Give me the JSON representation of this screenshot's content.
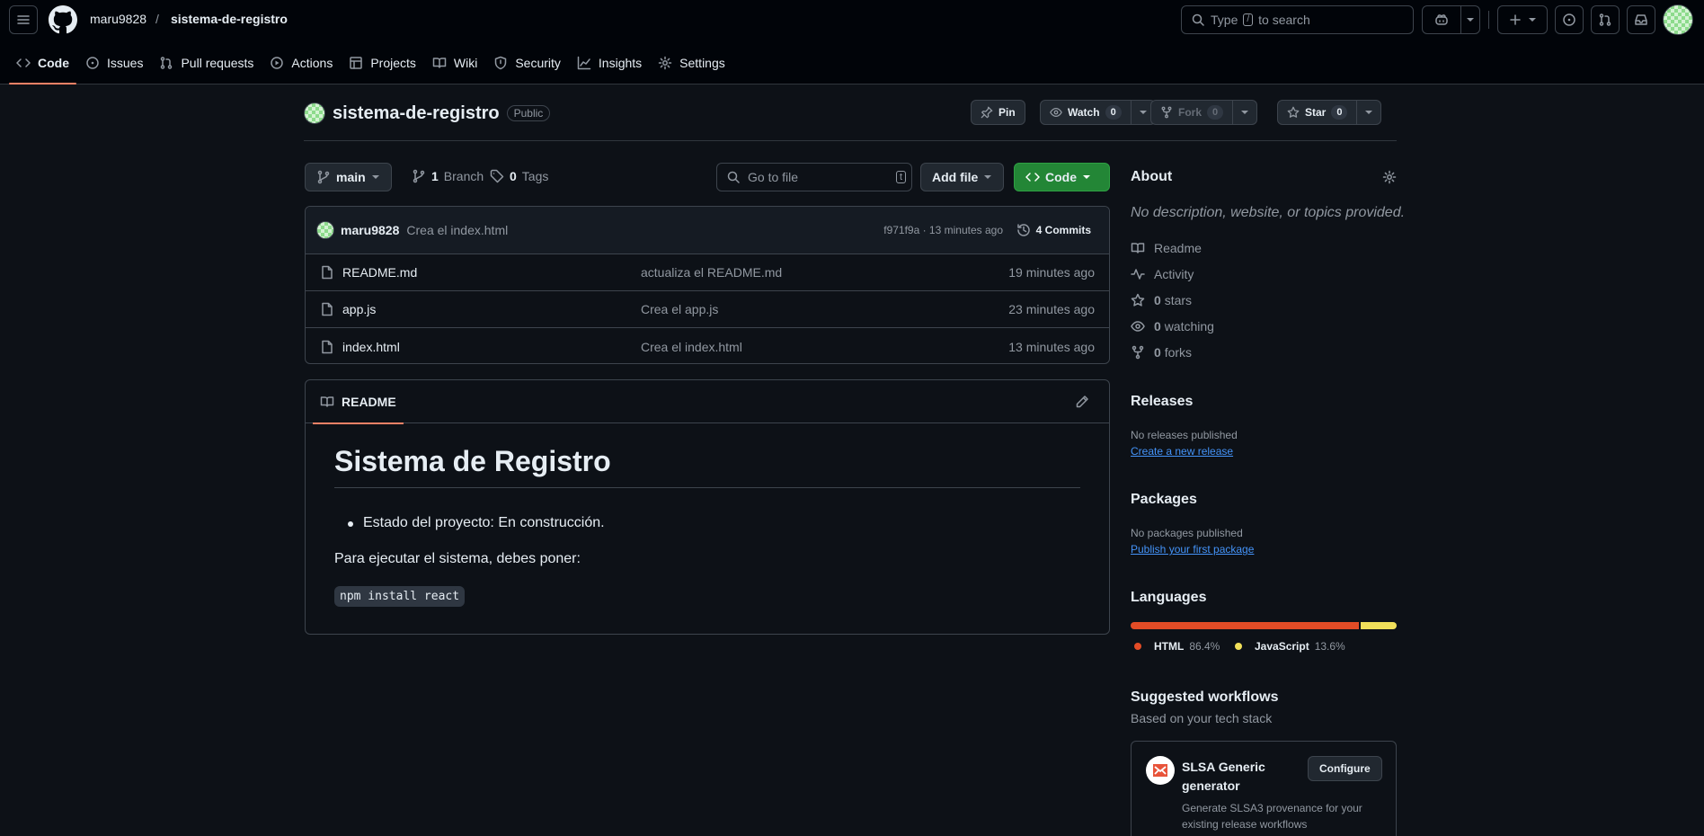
{
  "header": {
    "owner": "maru9828",
    "separator": "/",
    "repo": "sistema-de-registro",
    "search_prefix": "Type",
    "search_key": "/",
    "search_suffix": "to search"
  },
  "tabs": [
    {
      "label": "Code",
      "icon": "code-icon"
    },
    {
      "label": "Issues",
      "icon": "issue-icon"
    },
    {
      "label": "Pull requests",
      "icon": "pull-request-icon"
    },
    {
      "label": "Actions",
      "icon": "play-icon"
    },
    {
      "label": "Projects",
      "icon": "table-icon"
    },
    {
      "label": "Wiki",
      "icon": "book-icon"
    },
    {
      "label": "Security",
      "icon": "shield-icon"
    },
    {
      "label": "Insights",
      "icon": "graph-icon"
    },
    {
      "label": "Settings",
      "icon": "gear-icon"
    }
  ],
  "repo": {
    "name": "sistema-de-registro",
    "visibility": "Public",
    "pin": "Pin",
    "watch": "Watch",
    "watch_count": "0",
    "fork": "Fork",
    "fork_count": "0",
    "star": "Star",
    "star_count": "0"
  },
  "toolbar": {
    "branch": "main",
    "branch_count": "1",
    "branch_label": "Branch",
    "tag_count": "0",
    "tag_label": "Tags",
    "go_to_file": "Go to file",
    "go_to_file_key": "t",
    "add_file": "Add file",
    "code": "Code"
  },
  "commit": {
    "author": "maru9828",
    "message": "Crea el index.html",
    "hash_time": "f971f9a · 13 minutes ago",
    "commits": "4 Commits"
  },
  "files": [
    {
      "name": "README.md",
      "message": "actualiza el README.md",
      "time": "19 minutes ago"
    },
    {
      "name": "app.js",
      "message": "Crea el app.js",
      "time": "23 minutes ago"
    },
    {
      "name": "index.html",
      "message": "Crea el index.html",
      "time": "13 minutes ago"
    }
  ],
  "readme": {
    "tab": "README",
    "title": "Sistema de Registro",
    "bullet": "Estado del proyecto: En construcción.",
    "paragraph": "Para ejecutar el sistema, debes poner:",
    "code": "npm install react"
  },
  "about": {
    "title": "About",
    "description": "No description, website, or topics provided.",
    "readme": "Readme",
    "activity": "Activity",
    "stars_count": "0",
    "stars_label": "stars",
    "watching_count": "0",
    "watching_label": "watching",
    "forks_count": "0",
    "forks_label": "forks"
  },
  "releases": {
    "title": "Releases",
    "text": "No releases published",
    "link": "Create a new release"
  },
  "packages": {
    "title": "Packages",
    "text": "No packages published",
    "link": "Publish your first package"
  },
  "languages": {
    "title": "Languages",
    "items": [
      {
        "name": "HTML",
        "percent": "86.4%",
        "value": 86.4,
        "color": "#e34c26"
      },
      {
        "name": "JavaScript",
        "percent": "13.6%",
        "value": 13.6,
        "color": "#f1e05a"
      }
    ]
  },
  "workflows": {
    "title": "Suggested workflows",
    "subtitle": "Based on your tech stack",
    "card_title": "SLSA Generic generator",
    "card_desc": "Generate SLSA3 provenance for your existing release workflows",
    "configure": "Configure"
  },
  "colors": {
    "accent": "#f78166",
    "green": "#238636",
    "link": "#4493f8"
  }
}
